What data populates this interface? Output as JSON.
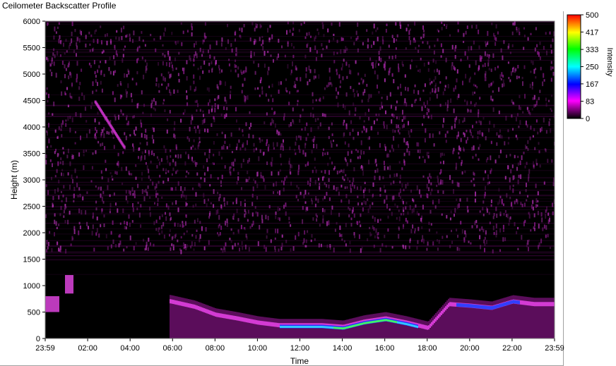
{
  "window": {
    "title": "Ceilometer Backscatter Profile"
  },
  "chart_data": {
    "type": "heatmap",
    "title": "Ceilometer Backscatter Profile",
    "xlabel": "Time",
    "ylabel": "Height (m)",
    "x_ticks": [
      "23:59",
      "02:00",
      "04:00",
      "06:00",
      "08:00",
      "10:00",
      "12:00",
      "14:00",
      "16:00",
      "18:00",
      "20:00",
      "22:00",
      "23:59"
    ],
    "x_range_hours": [
      -0.017,
      23.983
    ],
    "y_ticks": [
      0,
      500,
      1000,
      1500,
      2000,
      2500,
      3000,
      3500,
      4000,
      4500,
      5000,
      5500,
      6000
    ],
    "ylim": [
      0,
      6000
    ],
    "colorbar": {
      "label": "Intensity",
      "ticks": [
        500,
        417,
        333,
        250,
        167,
        83,
        0
      ],
      "range": [
        0,
        500
      ],
      "colors": [
        "#000000",
        "#ff00ff",
        "#0000ff",
        "#00ffff",
        "#00ff00",
        "#ffff00",
        "#ff0000"
      ]
    },
    "layer_profile": [
      {
        "t": 0.0,
        "h": 650
      },
      {
        "t": 0.5,
        "h": 600
      },
      {
        "t": 1.0,
        "h": 1000
      },
      {
        "t": 5.9,
        "h": 700
      },
      {
        "t": 7.0,
        "h": 600
      },
      {
        "t": 8.0,
        "h": 450
      },
      {
        "t": 9.0,
        "h": 380
      },
      {
        "t": 10.0,
        "h": 300
      },
      {
        "t": 11.0,
        "h": 250
      },
      {
        "t": 12.0,
        "h": 250
      },
      {
        "t": 13.0,
        "h": 250
      },
      {
        "t": 14.0,
        "h": 220
      },
      {
        "t": 15.0,
        "h": 320
      },
      {
        "t": 16.0,
        "h": 380
      },
      {
        "t": 17.0,
        "h": 300
      },
      {
        "t": 18.0,
        "h": 200
      },
      {
        "t": 19.0,
        "h": 650
      },
      {
        "t": 20.0,
        "h": 620
      },
      {
        "t": 21.0,
        "h": 580
      },
      {
        "t": 22.0,
        "h": 700
      },
      {
        "t": 23.0,
        "h": 650
      }
    ]
  }
}
